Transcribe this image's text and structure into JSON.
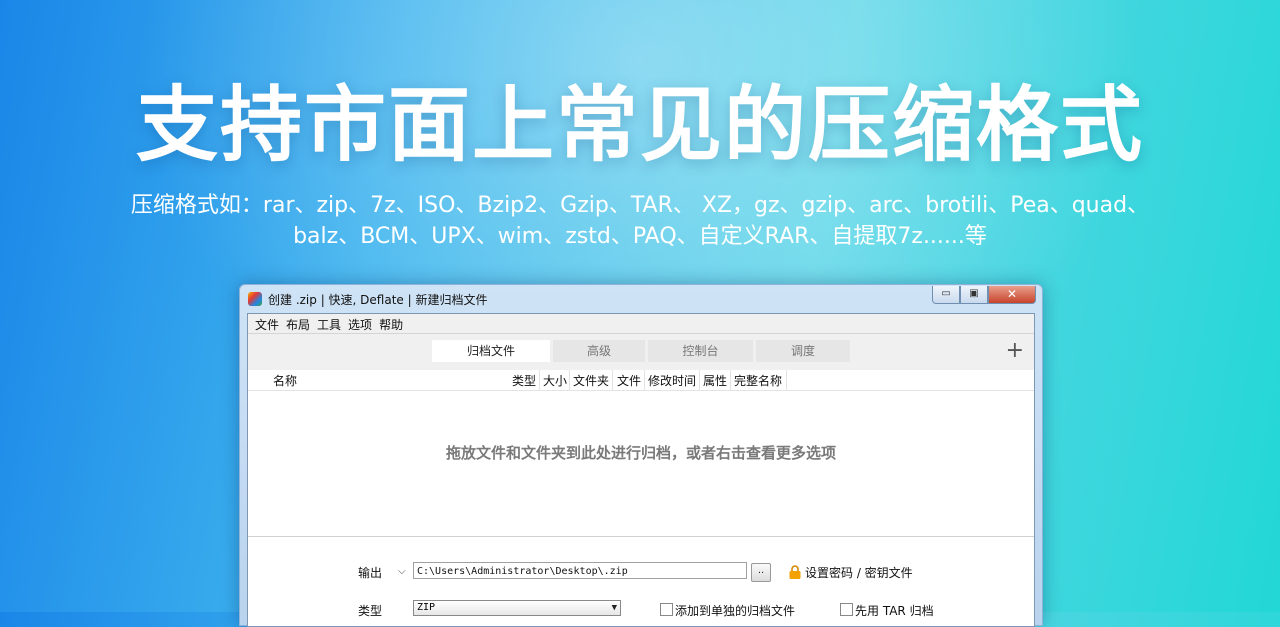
{
  "banner": {
    "headline": "支持市面上常见的压缩格式",
    "subtitle_line1": "压缩格式如：rar、zip、7z、ISO、Bzip2、Gzip、TAR、 XZ，gz、gzip、arc、brotili、Pea、quad、",
    "subtitle_line2": "balz、BCM、UPX、wim、zstd、PAQ、自定义RAR、自提取7z......等"
  },
  "window": {
    "title": "创建 .zip | 快速, Deflate | 新建归档文件",
    "close_glyph": "✕",
    "minimize_glyph": "▭",
    "maximize_glyph": "▣"
  },
  "menu": [
    "文件",
    "布局",
    "工具",
    "选项",
    "帮助"
  ],
  "tabs": [
    {
      "label": "归档文件",
      "active": true
    },
    {
      "label": "高级",
      "active": false
    },
    {
      "label": "控制台",
      "active": false
    },
    {
      "label": "调度",
      "active": false
    }
  ],
  "add_tab_glyph": "+",
  "columns": [
    "名称",
    "类型",
    "大小",
    "文件夹",
    "文件",
    "修改时间",
    "属性",
    "完整名称"
  ],
  "drop_hint": "拖放文件和文件夹到此处进行归档，或者右击查看更多选项",
  "output": {
    "label": "输出",
    "path": "C:\\Users\\Administrator\\Desktop\\.zip",
    "browse_label": "..",
    "password_link": "设置密码 / 密钥文件"
  },
  "type": {
    "label": "类型",
    "value": "ZIP",
    "add_separate_label": "添加到单独的归档文件",
    "use_tar_label": "先用 TAR 归档"
  },
  "icons": {
    "app": "archive-app-icon",
    "lock": "lock-icon",
    "dropdown": "chevron-down-icon"
  },
  "colors": {
    "background_start": "#1a86e8",
    "background_end": "#22d7d6",
    "lock": "#f2a100"
  }
}
